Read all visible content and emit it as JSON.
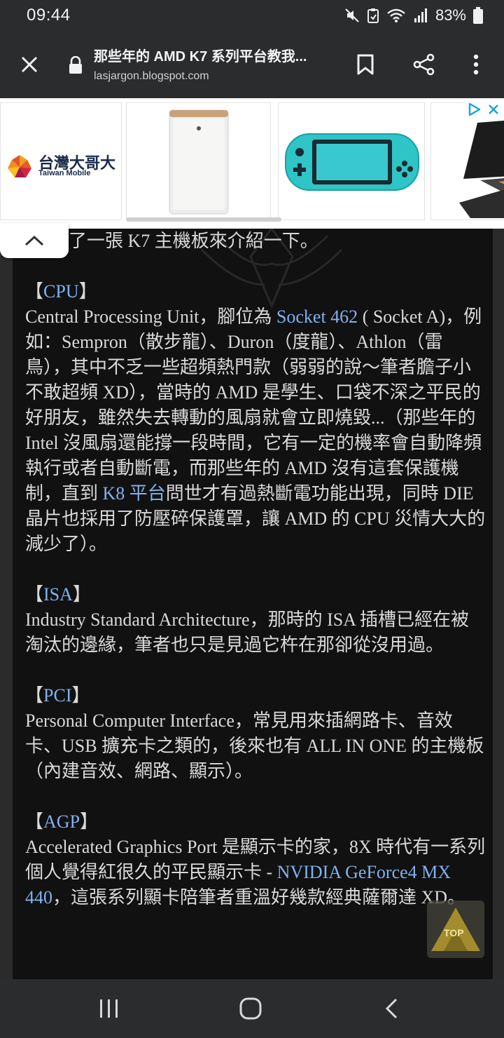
{
  "status_bar": {
    "time": "09:44",
    "battery": "83%",
    "icons": [
      "mute-icon",
      "clipboard-icon",
      "wifi-icon",
      "signal-icon",
      "battery-icon"
    ]
  },
  "toolbar": {
    "title": "那些年的 AMD K7 系列平台教我...",
    "url": "lasjargon.blogspot.com"
  },
  "ad": {
    "brand_cn": "台灣大哥大",
    "brand_en": "Taiwan Mobile"
  },
  "article": {
    "intro_fragment": "找了一張 K7 主機板來介紹一下。",
    "sections": [
      {
        "heading_open": "【",
        "heading": "CPU",
        "heading_close": "】",
        "p1": "Central Processing Unit，腳位為 ",
        "link1": "Socket 462",
        "p2": " ( Socket A)，例如：Sempron（散步龍）、Duron（度龍）、Athlon（雷鳥），其中不乏一些超頻熱門款（弱弱的說～筆者膽子小不敢超頻 XD），當時的 AMD 是學生、口袋不深之平民的好朋友，雖然失去轉動的風扇就會立即燒毀...（那些年的 Intel 沒風扇還能撐一段時間，它有一定的機率會自動降頻執行或者自動斷電，而那些年的 AMD 沒有這套保護機制，直到 ",
        "link2": "K8 平台",
        "p3": "問世才有過熱斷電功能出現，同時 DIE 晶片也採用了防壓碎保護罩，讓 AMD 的 CPU 災情大大的減少了）。"
      },
      {
        "heading_open": "【",
        "heading": "ISA",
        "heading_close": "】",
        "body": "Industry Standard Architecture，那時的 ISA 插槽已經在被淘汰的邊緣，筆者也只是見過它杵在那卻從沒用過。"
      },
      {
        "heading_open": "【",
        "heading": "PCI",
        "heading_close": "】",
        "body": "Personal Computer Interface，常見用來插網路卡、音效卡、USB 擴充卡之類的，後來也有 ALL IN ONE 的主機板（內建音效、網路、顯示）。"
      },
      {
        "heading_open": "【",
        "heading": "AGP",
        "heading_close": "】",
        "p1": "Accelerated Graphics Port 是顯示卡的家，8X 時代有一系列個人覺得紅很久的平民顯示卡 - ",
        "link1": "NVIDIA GeForce4 MX 440",
        "p2": "，這張系列顯卡陪筆者重溫好幾款經典薩爾達 XD。"
      }
    ]
  },
  "top_button": {
    "label": "TOP"
  },
  "colors": {
    "link": "#7fb2ef",
    "page_bg": "#111111",
    "toolbar_bg": "#2b2c2e"
  }
}
